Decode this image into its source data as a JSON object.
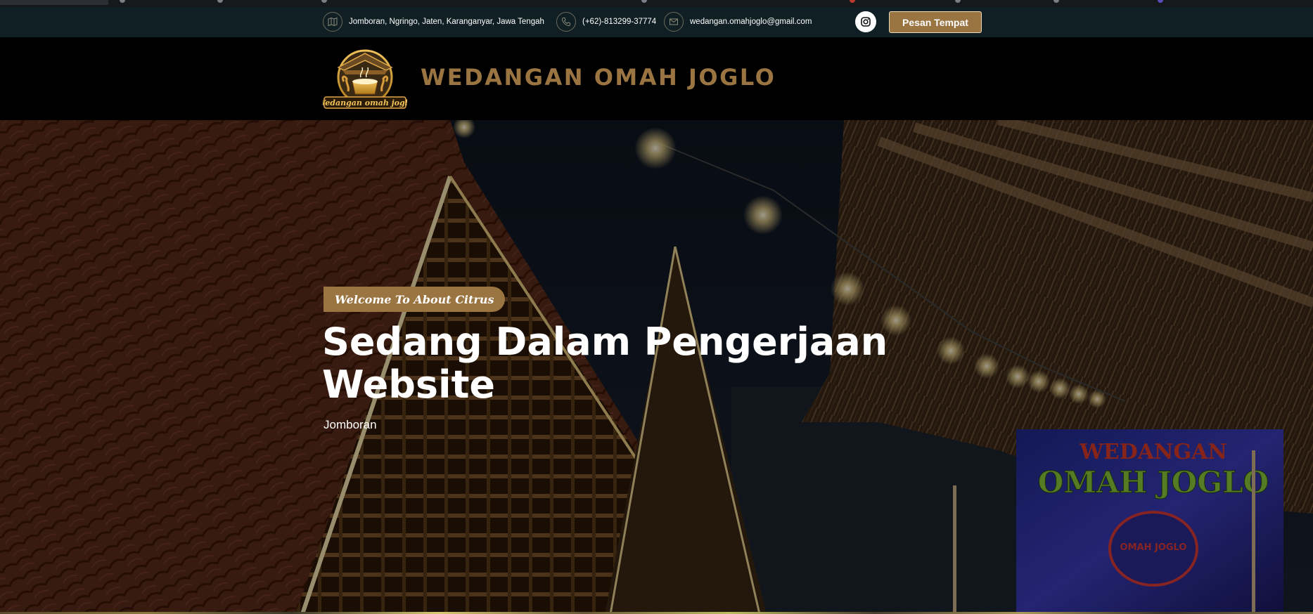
{
  "contact": {
    "address": "Jomboran, Ngringo, Jaten, Karanganyar, Jawa Tengah",
    "address_icon": "map-icon",
    "phone": "(+62)-813299-37774",
    "phone_icon": "phone-icon",
    "email": "wedangan.omahjoglo@gmail.com",
    "email_icon": "mail-icon"
  },
  "social": {
    "instagram_icon": "instagram-icon"
  },
  "topbar": {
    "book_label": "Pesan Tempat"
  },
  "header": {
    "brand_name": "WEDANGAN OMAH JOGLO",
    "logo_text": "Wedangan omah joglo"
  },
  "hero": {
    "welcome": "Welcome To About Citrus",
    "title": "Sedang Dalam Pengerjaan Website",
    "subtitle": "Jomboran",
    "sign_line1": "WEDANGAN",
    "sign_line2": "OMAH JOGLO",
    "sign_logo_text": "OMAH JOGLO"
  },
  "colors": {
    "accent": "#9a7441",
    "topbar_bg": "#0f1f24",
    "header_bg": "#000000"
  }
}
